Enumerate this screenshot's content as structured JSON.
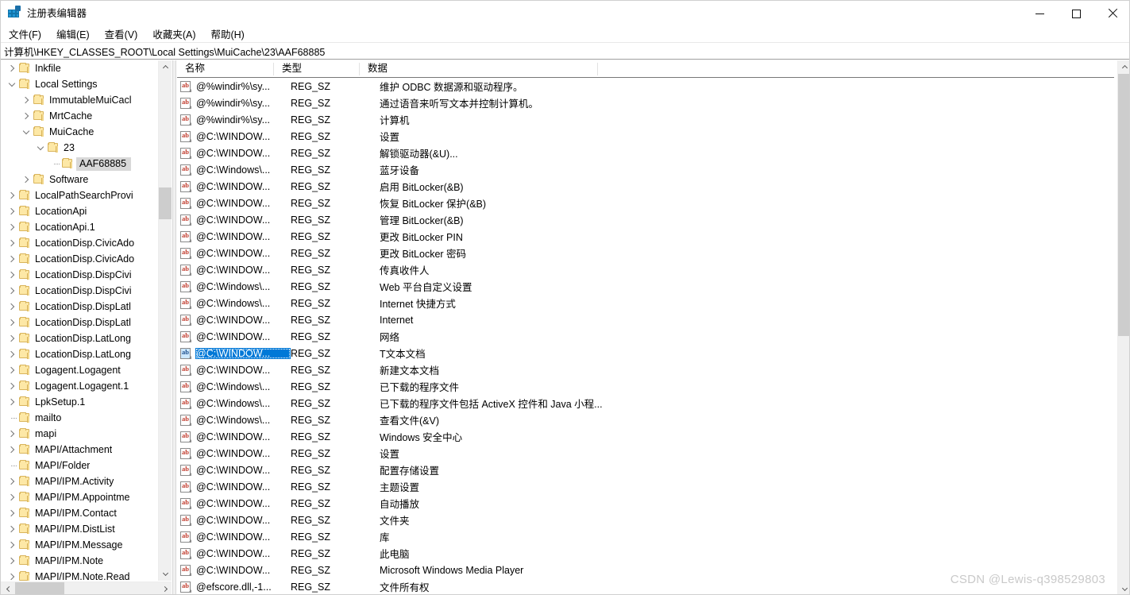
{
  "window": {
    "title": "注册表编辑器",
    "app_icon": "registry-editor-icon",
    "controls": {
      "minimize": "—",
      "maximize": "□",
      "close": "✕"
    }
  },
  "menubar": {
    "items": [
      {
        "label": "文件(F)",
        "name": "menu-file"
      },
      {
        "label": "编辑(E)",
        "name": "menu-edit"
      },
      {
        "label": "查看(V)",
        "name": "menu-view"
      },
      {
        "label": "收藏夹(A)",
        "name": "menu-favorites"
      },
      {
        "label": "帮助(H)",
        "name": "menu-help"
      }
    ]
  },
  "address": {
    "path": "计算机\\HKEY_CLASSES_ROOT\\Local Settings\\MuiCache\\23\\AAF68885"
  },
  "tree": {
    "nodes": [
      {
        "label": "Inkfile",
        "indent": 1,
        "twist": "closed",
        "selected": false
      },
      {
        "label": "Local Settings",
        "indent": 1,
        "twist": "open",
        "selected": false
      },
      {
        "label": "ImmutableMuiCacl",
        "indent": 2,
        "twist": "closed",
        "selected": false
      },
      {
        "label": "MrtCache",
        "indent": 2,
        "twist": "closed",
        "selected": false
      },
      {
        "label": "MuiCache",
        "indent": 2,
        "twist": "open",
        "selected": false
      },
      {
        "label": "23",
        "indent": 3,
        "twist": "open",
        "selected": false
      },
      {
        "label": "AAF68885",
        "indent": 4,
        "twist": "leaf",
        "selected": true
      },
      {
        "label": "Software",
        "indent": 2,
        "twist": "closed",
        "selected": false
      },
      {
        "label": "LocalPathSearchProvi",
        "indent": 1,
        "twist": "closed",
        "selected": false
      },
      {
        "label": "LocationApi",
        "indent": 1,
        "twist": "closed",
        "selected": false
      },
      {
        "label": "LocationApi.1",
        "indent": 1,
        "twist": "closed",
        "selected": false
      },
      {
        "label": "LocationDisp.CivicAdo",
        "indent": 1,
        "twist": "closed",
        "selected": false
      },
      {
        "label": "LocationDisp.CivicAdo",
        "indent": 1,
        "twist": "closed",
        "selected": false
      },
      {
        "label": "LocationDisp.DispCivi",
        "indent": 1,
        "twist": "closed",
        "selected": false
      },
      {
        "label": "LocationDisp.DispCivi",
        "indent": 1,
        "twist": "closed",
        "selected": false
      },
      {
        "label": "LocationDisp.DispLatl",
        "indent": 1,
        "twist": "closed",
        "selected": false
      },
      {
        "label": "LocationDisp.DispLatl",
        "indent": 1,
        "twist": "closed",
        "selected": false
      },
      {
        "label": "LocationDisp.LatLong",
        "indent": 1,
        "twist": "closed",
        "selected": false
      },
      {
        "label": "LocationDisp.LatLong",
        "indent": 1,
        "twist": "closed",
        "selected": false
      },
      {
        "label": "Logagent.Logagent",
        "indent": 1,
        "twist": "closed",
        "selected": false
      },
      {
        "label": "Logagent.Logagent.1",
        "indent": 1,
        "twist": "closed",
        "selected": false
      },
      {
        "label": "LpkSetup.1",
        "indent": 1,
        "twist": "closed",
        "selected": false
      },
      {
        "label": "mailto",
        "indent": 1,
        "twist": "leaf",
        "selected": false
      },
      {
        "label": "mapi",
        "indent": 1,
        "twist": "closed",
        "selected": false
      },
      {
        "label": "MAPI/Attachment",
        "indent": 1,
        "twist": "closed",
        "selected": false
      },
      {
        "label": "MAPI/Folder",
        "indent": 1,
        "twist": "leaf",
        "selected": false
      },
      {
        "label": "MAPI/IPM.Activity",
        "indent": 1,
        "twist": "closed",
        "selected": false
      },
      {
        "label": "MAPI/IPM.Appointme",
        "indent": 1,
        "twist": "closed",
        "selected": false
      },
      {
        "label": "MAPI/IPM.Contact",
        "indent": 1,
        "twist": "closed",
        "selected": false
      },
      {
        "label": "MAPI/IPM.DistList",
        "indent": 1,
        "twist": "closed",
        "selected": false
      },
      {
        "label": "MAPI/IPM.Message",
        "indent": 1,
        "twist": "closed",
        "selected": false
      },
      {
        "label": "MAPI/IPM.Note",
        "indent": 1,
        "twist": "closed",
        "selected": false
      },
      {
        "label": "MAPI/IPM.Note.Read",
        "indent": 1,
        "twist": "closed",
        "selected": false
      }
    ]
  },
  "list": {
    "columns": [
      {
        "label": "名称",
        "name": "column-name"
      },
      {
        "label": "类型",
        "name": "column-type"
      },
      {
        "label": "数据",
        "name": "column-data"
      }
    ],
    "rows": [
      {
        "name": "@%windir%\\sy...",
        "type": "REG_SZ",
        "data": "维护 ODBC 数据源和驱动程序。",
        "selected": false
      },
      {
        "name": "@%windir%\\sy...",
        "type": "REG_SZ",
        "data": "通过语音来听写文本并控制计算机。",
        "selected": false
      },
      {
        "name": "@%windir%\\sy...",
        "type": "REG_SZ",
        "data": "计算机",
        "selected": false
      },
      {
        "name": "@C:\\WINDOW...",
        "type": "REG_SZ",
        "data": "设置",
        "selected": false
      },
      {
        "name": "@C:\\WINDOW...",
        "type": "REG_SZ",
        "data": "解锁驱动器(&U)...",
        "selected": false
      },
      {
        "name": "@C:\\Windows\\...",
        "type": "REG_SZ",
        "data": "蓝牙设备",
        "selected": false
      },
      {
        "name": "@C:\\WINDOW...",
        "type": "REG_SZ",
        "data": "启用 BitLocker(&B)",
        "selected": false
      },
      {
        "name": "@C:\\WINDOW...",
        "type": "REG_SZ",
        "data": "恢复 BitLocker 保护(&B)",
        "selected": false
      },
      {
        "name": "@C:\\WINDOW...",
        "type": "REG_SZ",
        "data": "管理 BitLocker(&B)",
        "selected": false
      },
      {
        "name": "@C:\\WINDOW...",
        "type": "REG_SZ",
        "data": "更改 BitLocker PIN",
        "selected": false
      },
      {
        "name": "@C:\\WINDOW...",
        "type": "REG_SZ",
        "data": "更改 BitLocker 密码",
        "selected": false
      },
      {
        "name": "@C:\\WINDOW...",
        "type": "REG_SZ",
        "data": "传真收件人",
        "selected": false
      },
      {
        "name": "@C:\\Windows\\...",
        "type": "REG_SZ",
        "data": "Web 平台自定义设置",
        "selected": false
      },
      {
        "name": "@C:\\Windows\\...",
        "type": "REG_SZ",
        "data": "Internet 快捷方式",
        "selected": false
      },
      {
        "name": "@C:\\WINDOW...",
        "type": "REG_SZ",
        "data": "Internet",
        "selected": false
      },
      {
        "name": "@C:\\WINDOW...",
        "type": "REG_SZ",
        "data": "网络",
        "selected": false
      },
      {
        "name": "@C:\\WINDOW...",
        "type": "REG_SZ",
        "data": "T文本文档",
        "selected": true
      },
      {
        "name": "@C:\\WINDOW...",
        "type": "REG_SZ",
        "data": "新建文本文档",
        "selected": false
      },
      {
        "name": "@C:\\Windows\\...",
        "type": "REG_SZ",
        "data": "已下载的程序文件",
        "selected": false
      },
      {
        "name": "@C:\\Windows\\...",
        "type": "REG_SZ",
        "data": "已下载的程序文件包括 ActiveX 控件和 Java 小程...",
        "selected": false
      },
      {
        "name": "@C:\\Windows\\...",
        "type": "REG_SZ",
        "data": "查看文件(&V)",
        "selected": false
      },
      {
        "name": "@C:\\WINDOW...",
        "type": "REG_SZ",
        "data": "Windows 安全中心",
        "selected": false
      },
      {
        "name": "@C:\\WINDOW...",
        "type": "REG_SZ",
        "data": "设置",
        "selected": false
      },
      {
        "name": "@C:\\WINDOW...",
        "type": "REG_SZ",
        "data": "配置存储设置",
        "selected": false
      },
      {
        "name": "@C:\\WINDOW...",
        "type": "REG_SZ",
        "data": "主题设置",
        "selected": false
      },
      {
        "name": "@C:\\WINDOW...",
        "type": "REG_SZ",
        "data": "自动播放",
        "selected": false
      },
      {
        "name": "@C:\\WINDOW...",
        "type": "REG_SZ",
        "data": "文件夹",
        "selected": false
      },
      {
        "name": "@C:\\WINDOW...",
        "type": "REG_SZ",
        "data": "库",
        "selected": false
      },
      {
        "name": "@C:\\WINDOW...",
        "type": "REG_SZ",
        "data": "此电脑",
        "selected": false
      },
      {
        "name": "@C:\\WINDOW...",
        "type": "REG_SZ",
        "data": "Microsoft Windows Media Player",
        "selected": false
      },
      {
        "name": "@efscore.dll,-1...",
        "type": "REG_SZ",
        "data": "文件所有权",
        "selected": false
      }
    ]
  },
  "watermark": {
    "text": "CSDN @Lewis-q398529803"
  },
  "colors": {
    "selection_blue": "#0078d7",
    "tree_selection_gray": "#d8d8d8",
    "folder_yellow": "#fde8a6",
    "scrollbar_thumb": "#cdcdcd",
    "watermark_gray": "#c9c9c9"
  }
}
